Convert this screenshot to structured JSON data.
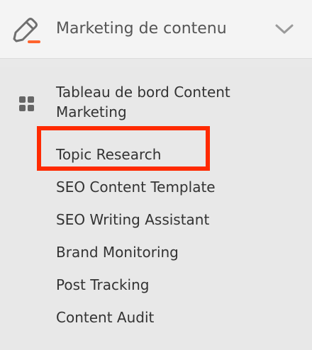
{
  "header": {
    "title": "Marketing de contenu"
  },
  "menu": {
    "items": [
      {
        "label": "Tableau de bord Content Marketing"
      },
      {
        "label": "Topic Research"
      },
      {
        "label": "SEO Content Template"
      },
      {
        "label": "SEO Writing Assistant"
      },
      {
        "label": "Brand Monitoring"
      },
      {
        "label": "Post Tracking"
      },
      {
        "label": "Content Audit"
      }
    ]
  },
  "colors": {
    "header_bg": "#f4f4f4",
    "submenu_bg": "#e8e8e8",
    "text": "#333333",
    "muted_text": "#555555",
    "accent": "#ff642d",
    "highlight": "#ff2a00"
  },
  "icons": {
    "header": "pencil-edit-icon",
    "collapse": "chevron-down-icon",
    "dashboard": "grid-icon"
  }
}
